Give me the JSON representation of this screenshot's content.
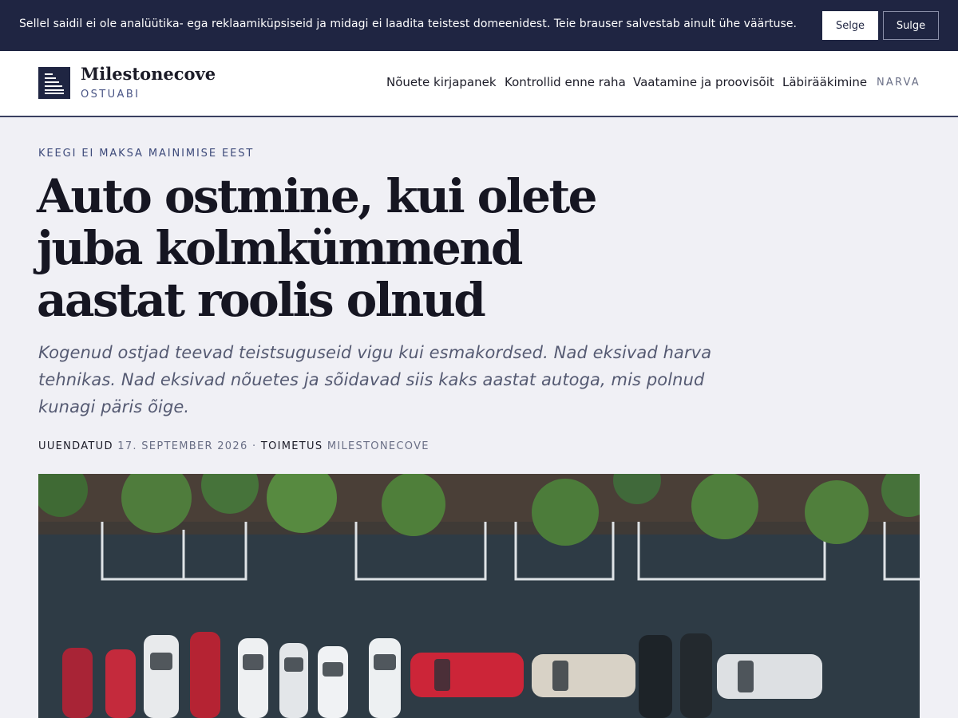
{
  "cookie_bar": {
    "text": "Sellel saidil ei ole analüütika- ega reklaamiküpsiseid ja midagi ei laadita teistest domeenidest. Teie brauser salvestab ainult ühe väärtuse.",
    "accept_label": "Selge",
    "close_label": "Sulge",
    "bg_color": "#1f2542"
  },
  "header": {
    "brand_name": "Milestonecove",
    "brand_sub": "OSTUABI",
    "logo_icon": "bar-list-icon",
    "nav": [
      {
        "label": "Nõuete kirjapanek"
      },
      {
        "label": "Kontrollid enne raha"
      },
      {
        "label": "Vaatamine ja proovisõit"
      },
      {
        "label": "Läbirääkimine"
      }
    ],
    "location": "NARVA"
  },
  "article": {
    "kicker": "KEEGI EI MAKSA MAINIMISE EEST",
    "headline": "Auto ostmine, kui olete juba kolmkümmend aastat roolis olnud",
    "dek": "Kogenud ostjad teevad teistsuguseid vigu kui esmakordsed. Nad eksivad harva tehnikas. Nad eksivad nõuetes ja sõidavad siis kaks aastat autoga, mis polnud kunagi päris õige.",
    "meta": {
      "updated_label": "UUENDATUD",
      "updated_value": "17. SEPTEMBER 2026",
      "separator": "·",
      "author_label": "TOIMETUS",
      "author_value": "MILESTONECOVE"
    },
    "hero_image": "aerial-parking-lot-image"
  },
  "colors": {
    "accent": "#3d4a7a",
    "navy": "#1f2542",
    "page_bg": "#f0f0f5"
  }
}
